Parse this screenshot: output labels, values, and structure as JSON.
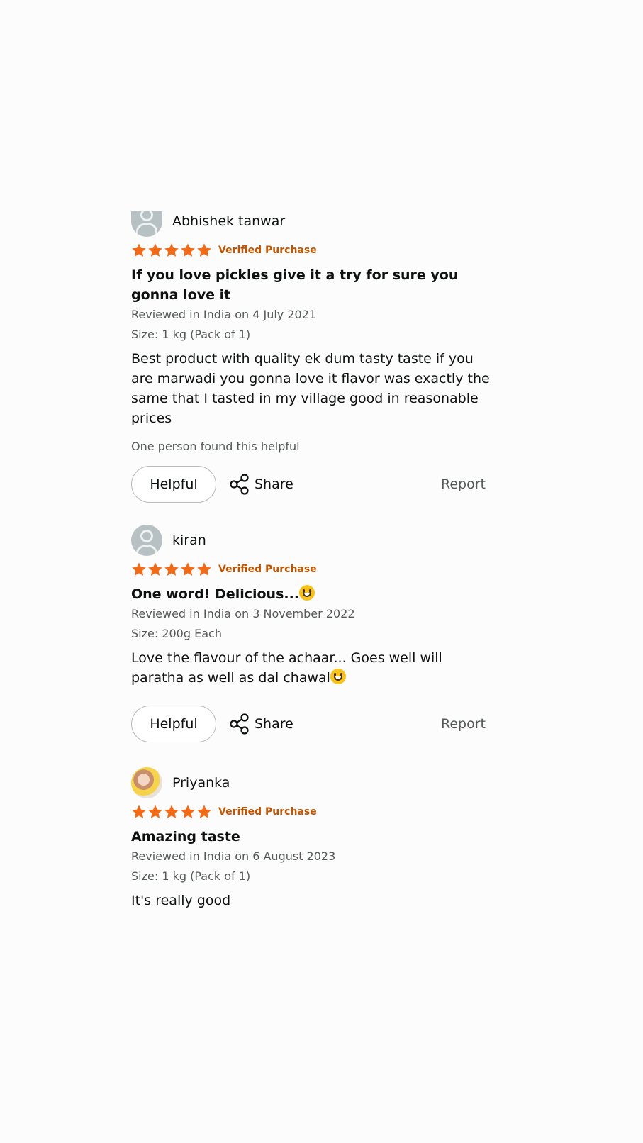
{
  "reviews": [
    {
      "name": "Abhishek tanwar",
      "avatar": "default-avatar-icon",
      "rating": 5,
      "verified": "Verified Purchase",
      "title": "If you love pickles give it a try for sure you gonna love it",
      "reviewed": "Reviewed in India on 4 July 2021",
      "size": "Size: 1 kg (Pack of 1)",
      "body": "Best product with quality ek dum tasty taste if you are marwadi you gonna love it flavor was exactly the same that I tasted in my village good in reasonable prices",
      "helpful_count": "One person found this helpful",
      "helpful_label": "Helpful",
      "share_label": "Share",
      "report_label": "Report"
    },
    {
      "name": "kiran",
      "avatar": "default-avatar-icon",
      "rating": 5,
      "verified": "Verified Purchase",
      "title": "One word! Delicious...",
      "reviewed": "Reviewed in India on 3 November 2022",
      "size": "Size: 200g Each",
      "body": "Love the flavour of the achaar... Goes well will paratha as well as dal chawal",
      "helpful_label": "Helpful",
      "share_label": "Share",
      "report_label": "Report"
    },
    {
      "name": "Priyanka",
      "avatar": "photo-avatar",
      "rating": 5,
      "verified": "Verified Purchase",
      "title": "Amazing taste",
      "reviewed": "Reviewed in India on 6 August 2023",
      "size": "Size: 1 kg (Pack of 1)",
      "body": "It's really good"
    }
  ],
  "colors": {
    "star": "#f06a18",
    "verified": "#c45500",
    "meta": "#565959",
    "text": "#0f1111"
  }
}
